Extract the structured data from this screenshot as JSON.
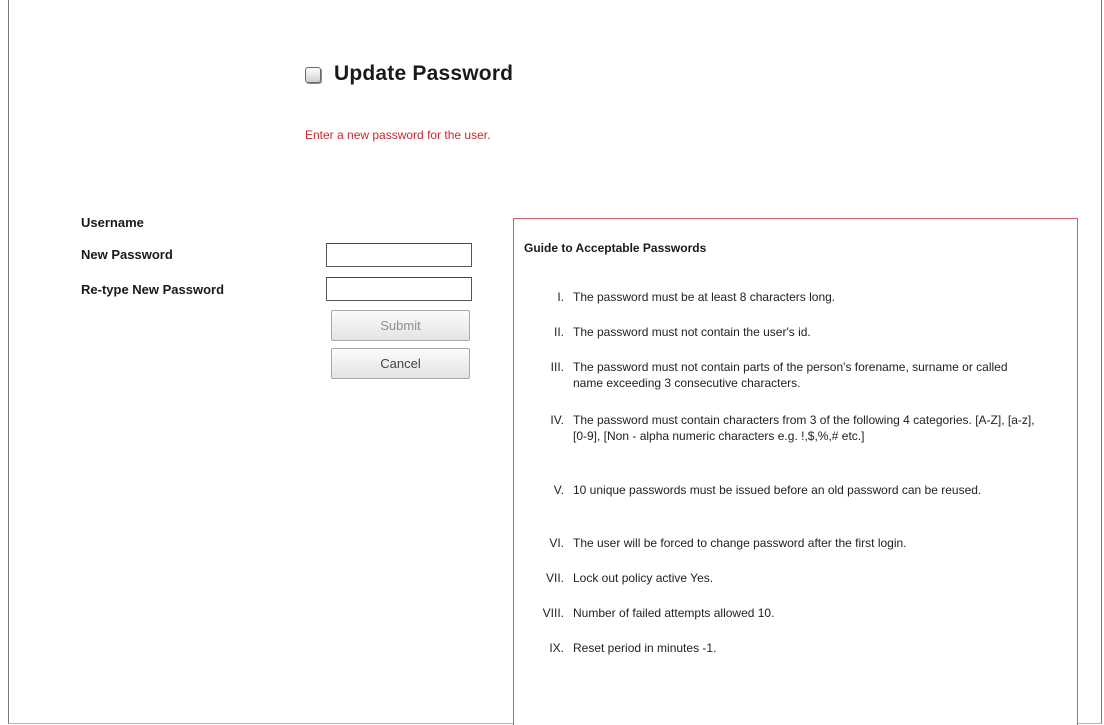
{
  "header": {
    "title": "Update Password",
    "icon": "window-checkbox-icon"
  },
  "instruction": "Enter a new password for the user.",
  "form": {
    "username_label": "Username",
    "new_password_label": "New Password",
    "retype_label": "Re-type New Password",
    "new_password_value": "",
    "retype_value": "",
    "submit_label": "Submit",
    "cancel_label": "Cancel"
  },
  "guide": {
    "title": "Guide to Acceptable Passwords",
    "rules": [
      {
        "num": "I.",
        "text": "The password must be at least 8 characters long."
      },
      {
        "num": "II.",
        "text": "The password must not contain the user's id."
      },
      {
        "num": "III.",
        "text": "The password must not contain parts of the person's forename, surname or called name exceeding 3 consecutive characters."
      },
      {
        "num": "IV.",
        "text": "The password must contain characters from 3 of the following 4 categories. [A-Z], [a-z], [0-9], [Non - alpha numeric characters e.g. !,$,%,# etc.]"
      },
      {
        "num": "V.",
        "text": "10 unique passwords must be issued before an old password can be reused."
      },
      {
        "num": "VI.",
        "text": "The user will be forced to change password after the first login."
      },
      {
        "num": "VII.",
        "text": "Lock out policy active Yes."
      },
      {
        "num": "VIII.",
        "text": "Number of failed attempts allowed 10."
      },
      {
        "num": "IX.",
        "text": "Reset period in minutes -1."
      }
    ]
  },
  "colors": {
    "instruction": "#d0262b",
    "guide_border": "#d65a5f"
  }
}
